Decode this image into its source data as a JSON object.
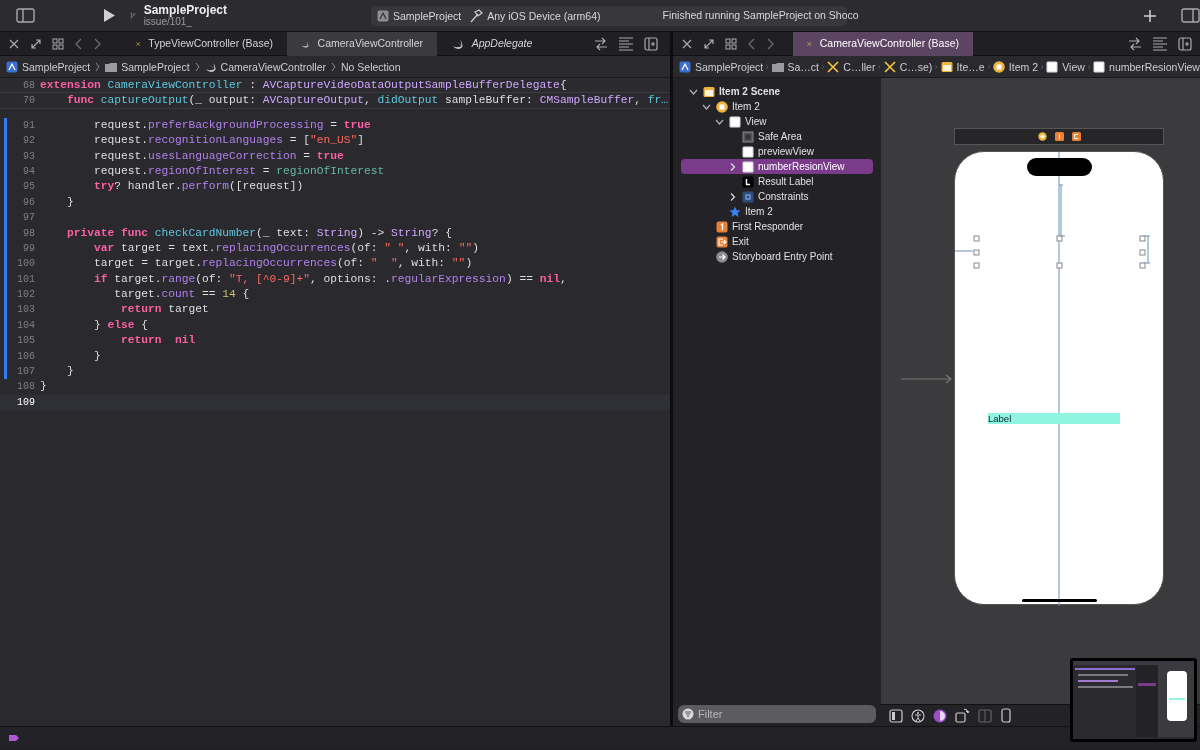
{
  "toolbar": {
    "project": "SampleProject",
    "branch": "issue/101_",
    "scheme": "SampleProject",
    "destination": "Any iOS Device (arm64)",
    "status": "Finished running SampleProject on Shoco"
  },
  "left_editor": {
    "tabs": [
      {
        "label": "TypeViewController (Base)",
        "kind": "storyboard",
        "selected": false,
        "preview": false
      },
      {
        "label": "CameraViewController",
        "kind": "swift",
        "selected": true,
        "preview": false
      },
      {
        "label": "AppDelegate",
        "kind": "swift",
        "selected": false,
        "preview": true
      }
    ],
    "breadcrumb": [
      {
        "label": "SampleProject",
        "kind": "project"
      },
      {
        "label": "SampleProject",
        "kind": "folder"
      },
      {
        "label": "CameraViewController",
        "kind": "swift"
      },
      {
        "label": "No Selection",
        "kind": "none"
      }
    ],
    "sticky_lines": [
      {
        "num": "68",
        "tokens": [
          {
            "kind": "kw",
            "text": "extension "
          },
          {
            "kind": "decl",
            "text": "CameraViewController"
          },
          {
            "kind": "plain",
            "text": " : "
          },
          {
            "kind": "type",
            "text": "AVCaptureVideoDataOutputSampleBufferDelegate"
          },
          {
            "kind": "plain",
            "text": "{"
          }
        ]
      },
      {
        "num": "70",
        "tokens": [
          {
            "kind": "kw",
            "text": "    func "
          },
          {
            "kind": "decl",
            "text": "captureOutput"
          },
          {
            "kind": "plain",
            "text": "(_ output: "
          },
          {
            "kind": "type",
            "text": "AVCaptureOutput"
          },
          {
            "kind": "plain",
            "text": ", "
          },
          {
            "kind": "decl",
            "text": "didOutput"
          },
          {
            "kind": "plain",
            "text": " sampleBuffer: "
          },
          {
            "kind": "type",
            "text": "CMSampleBuffer"
          },
          {
            "kind": "plain",
            "text": ", "
          },
          {
            "kind": "decl",
            "text": "fr…"
          }
        ]
      }
    ],
    "lines": [
      {
        "num": "91",
        "changed": true,
        "current": false,
        "tokens": [
          {
            "kind": "plain",
            "text": "        request."
          },
          {
            "kind": "sys",
            "text": "preferBackgroundProcessing"
          },
          {
            "kind": "plain",
            "text": " = "
          },
          {
            "kind": "kw",
            "text": "true"
          }
        ]
      },
      {
        "num": "92",
        "changed": true,
        "current": false,
        "tokens": [
          {
            "kind": "plain",
            "text": "        request."
          },
          {
            "kind": "sys",
            "text": "recognitionLanguages"
          },
          {
            "kind": "plain",
            "text": " = ["
          },
          {
            "kind": "str",
            "text": "\"en_US\""
          },
          {
            "kind": "plain",
            "text": "]"
          }
        ]
      },
      {
        "num": "93",
        "changed": true,
        "current": false,
        "tokens": [
          {
            "kind": "plain",
            "text": "        request."
          },
          {
            "kind": "sys",
            "text": "usesLanguageCorrection"
          },
          {
            "kind": "plain",
            "text": " = "
          },
          {
            "kind": "kw",
            "text": "true"
          }
        ]
      },
      {
        "num": "94",
        "changed": true,
        "current": false,
        "tokens": [
          {
            "kind": "plain",
            "text": "        request."
          },
          {
            "kind": "sys",
            "text": "regionOfInterest"
          },
          {
            "kind": "plain",
            "text": " = "
          },
          {
            "kind": "proj",
            "text": "regionOfInterest"
          }
        ]
      },
      {
        "num": "95",
        "changed": true,
        "current": false,
        "tokens": [
          {
            "kind": "kw",
            "text": "        try"
          },
          {
            "kind": "plain",
            "text": "? handler."
          },
          {
            "kind": "sys",
            "text": "perform"
          },
          {
            "kind": "plain",
            "text": "([request])"
          }
        ]
      },
      {
        "num": "96",
        "changed": true,
        "current": false,
        "tokens": [
          {
            "kind": "plain",
            "text": "    }"
          }
        ]
      },
      {
        "num": "97",
        "changed": true,
        "current": false
      },
      {
        "num": "98",
        "changed": true,
        "current": false,
        "tokens": [
          {
            "kind": "kw",
            "text": "    private func "
          },
          {
            "kind": "decl",
            "text": "checkCardNumber"
          },
          {
            "kind": "plain",
            "text": "(_ text: "
          },
          {
            "kind": "type",
            "text": "String"
          },
          {
            "kind": "plain",
            "text": ") -> "
          },
          {
            "kind": "type",
            "text": "String"
          },
          {
            "kind": "plain",
            "text": "? {"
          }
        ]
      },
      {
        "num": "99",
        "changed": true,
        "current": false,
        "tokens": [
          {
            "kind": "kw",
            "text": "        var"
          },
          {
            "kind": "plain",
            "text": " target = text."
          },
          {
            "kind": "sys",
            "text": "replacingOccurrences"
          },
          {
            "kind": "plain",
            "text": "(of: "
          },
          {
            "kind": "str",
            "text": "\" \""
          },
          {
            "kind": "plain",
            "text": ", with: "
          },
          {
            "kind": "str",
            "text": "\"\""
          },
          {
            "kind": "plain",
            "text": ")"
          }
        ]
      },
      {
        "num": "100",
        "changed": true,
        "current": false,
        "tokens": [
          {
            "kind": "plain",
            "text": "        target = target."
          },
          {
            "kind": "sys",
            "text": "replacingOccurrences"
          },
          {
            "kind": "plain",
            "text": "(of: "
          },
          {
            "kind": "str",
            "text": "\"  \""
          },
          {
            "kind": "plain",
            "text": ", with: "
          },
          {
            "kind": "str",
            "text": "\"\""
          },
          {
            "kind": "plain",
            "text": ")"
          }
        ]
      },
      {
        "num": "101",
        "changed": true,
        "current": false,
        "tokens": [
          {
            "kind": "kw",
            "text": "        if"
          },
          {
            "kind": "plain",
            "text": " target."
          },
          {
            "kind": "sys",
            "text": "range"
          },
          {
            "kind": "plain",
            "text": "(of: "
          },
          {
            "kind": "str",
            "text": "\"T, [^0-9]+\""
          },
          {
            "kind": "plain",
            "text": ", options: ."
          },
          {
            "kind": "sys",
            "text": "regularExpression"
          },
          {
            "kind": "plain",
            "text": ") == "
          },
          {
            "kind": "kw",
            "text": "nil"
          },
          {
            "kind": "plain",
            "text": ","
          }
        ]
      },
      {
        "num": "102",
        "changed": true,
        "current": false,
        "tokens": [
          {
            "kind": "plain",
            "text": "           target."
          },
          {
            "kind": "sys",
            "text": "count"
          },
          {
            "kind": "plain",
            "text": " == "
          },
          {
            "kind": "num",
            "text": "14"
          },
          {
            "kind": "plain",
            "text": " {"
          }
        ]
      },
      {
        "num": "103",
        "changed": true,
        "current": false,
        "tokens": [
          {
            "kind": "kw",
            "text": "            return"
          },
          {
            "kind": "plain",
            "text": " target"
          }
        ]
      },
      {
        "num": "104",
        "changed": true,
        "current": false,
        "tokens": [
          {
            "kind": "plain",
            "text": "        } "
          },
          {
            "kind": "kw",
            "text": "else"
          },
          {
            "kind": "plain",
            "text": " {"
          }
        ]
      },
      {
        "num": "105",
        "changed": true,
        "current": false,
        "tokens": [
          {
            "kind": "kw",
            "text": "            return  nil"
          }
        ]
      },
      {
        "num": "106",
        "changed": true,
        "current": false,
        "tokens": [
          {
            "kind": "plain",
            "text": "        }"
          }
        ]
      },
      {
        "num": "107",
        "changed": true,
        "current": false,
        "tokens": [
          {
            "kind": "plain",
            "text": "    }"
          }
        ]
      },
      {
        "num": "108",
        "changed": false,
        "current": false,
        "tokens": [
          {
            "kind": "plain",
            "text": "}"
          }
        ]
      },
      {
        "num": "109",
        "changed": false,
        "current": true
      }
    ]
  },
  "right_editor": {
    "tabs": [
      {
        "label": "CameraViewController (Base)",
        "kind": "storyboard",
        "selected": true,
        "preview": false
      }
    ],
    "breadcrumb": [
      {
        "label": "SampleProject",
        "kind": "project"
      },
      {
        "label": "Sa…ct",
        "kind": "folder"
      },
      {
        "label": "C…ller",
        "kind": "storyboard"
      },
      {
        "label": "C…se)",
        "kind": "storyboard"
      },
      {
        "label": "Ite…e",
        "kind": "scene"
      },
      {
        "label": "Item 2",
        "kind": "controller"
      },
      {
        "label": "View",
        "kind": "view"
      },
      {
        "label": "numberResionView",
        "kind": "view"
      }
    ],
    "outline": [
      {
        "label": "Item 2 Scene",
        "kind": "scene",
        "selected": false,
        "expanded": true,
        "children": [
          {
            "label": "Item 2",
            "kind": "controller",
            "selected": false,
            "expanded": true,
            "children": [
              {
                "label": "View",
                "kind": "view",
                "selected": false,
                "expanded": true,
                "children": [
                  {
                    "label": "Safe Area",
                    "kind": "safe-area",
                    "selected": false
                  },
                  {
                    "label": "previewView",
                    "kind": "view",
                    "selected": false
                  },
                  {
                    "label": "numberResionView",
                    "kind": "view",
                    "selected": true,
                    "expanded": false
                  },
                  {
                    "label": "Result Label",
                    "kind": "label",
                    "selected": false
                  },
                  {
                    "label": "Constraints",
                    "kind": "constraints",
                    "selected": false,
                    "expanded": false
                  }
                ]
              },
              {
                "label": "Item 2",
                "kind": "bar-item",
                "selected": false
              }
            ]
          },
          {
            "label": "First Responder",
            "kind": "responder",
            "selected": false
          },
          {
            "label": "Exit",
            "kind": "exit",
            "selected": false
          },
          {
            "label": "Storyboard Entry Point",
            "kind": "entry",
            "selected": false
          }
        ]
      }
    ],
    "filter": {
      "placeholder": "Filter"
    },
    "canvas": {
      "label": "Label"
    }
  }
}
